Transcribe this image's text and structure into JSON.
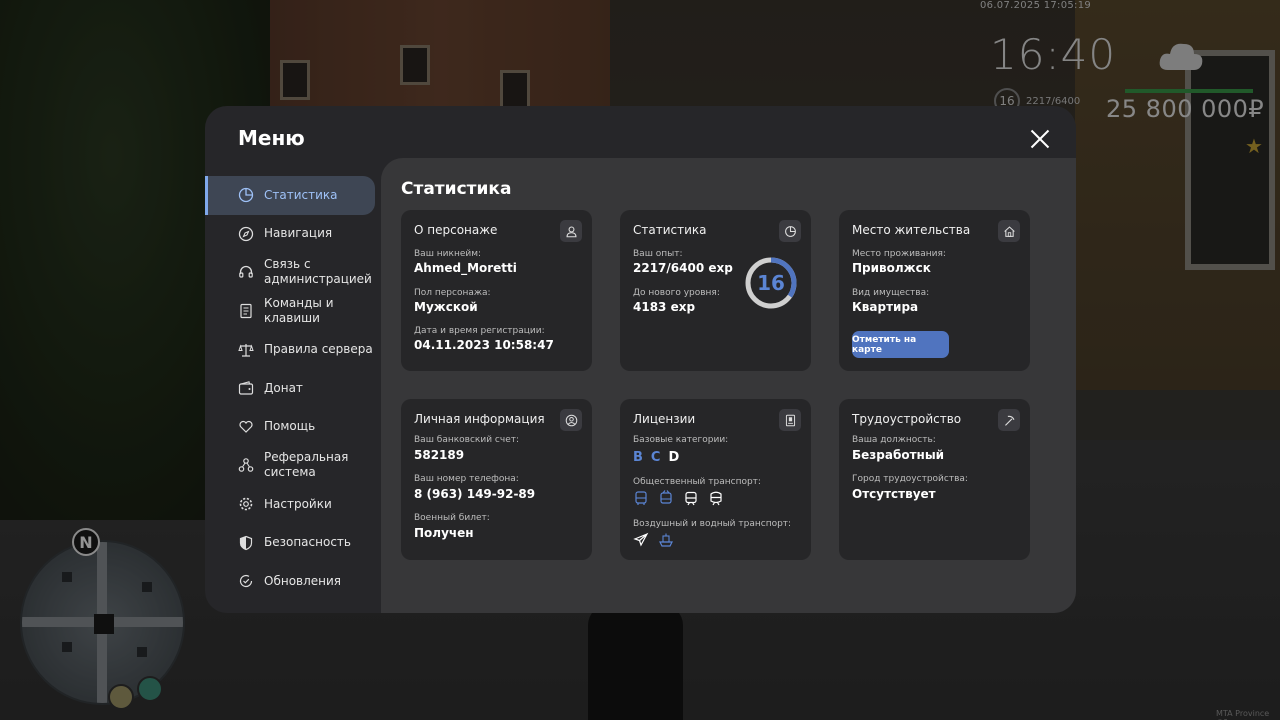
{
  "hud": {
    "datetime": "06.07.2025 17:05:19",
    "time": "16:40",
    "level": "16",
    "xp": "2217/6400",
    "money": "25 800 000₽",
    "brand": "MTA Province #6",
    "compass": "N"
  },
  "menu": {
    "title": "Меню",
    "sidebar": [
      {
        "label": "Статистика",
        "icon": "pie-chart-icon",
        "active": true
      },
      {
        "label": "Навигация",
        "icon": "compass-icon"
      },
      {
        "label": "Связь с администрацией",
        "icon": "headset-icon"
      },
      {
        "label": "Команды и клавиши",
        "icon": "document-icon"
      },
      {
        "label": "Правила сервера",
        "icon": "scales-icon"
      },
      {
        "label": "Донат",
        "icon": "wallet-icon"
      },
      {
        "label": "Помощь",
        "icon": "heart-hands-icon"
      },
      {
        "label": "Реферальная система",
        "icon": "network-icon"
      },
      {
        "label": "Настройки",
        "icon": "gear-icon"
      },
      {
        "label": "Безопасность",
        "icon": "shield-icon"
      },
      {
        "label": "Обновления",
        "icon": "refresh-check-icon"
      }
    ]
  },
  "content": {
    "title": "Статистика",
    "character": {
      "title": "О персонаже",
      "nick_label": "Ваш никнейм:",
      "nick": "Ahmed_Moretti",
      "gender_label": "Пол персонажа:",
      "gender": "Мужской",
      "reg_label": "Дата и время регистрации:",
      "reg": "04.11.2023 10:58:47"
    },
    "stats": {
      "title": "Статистика",
      "exp_label": "Ваш опыт:",
      "exp": "2217/6400 exp",
      "next_label": "До нового уровня:",
      "next": "4183 exp",
      "level": "16",
      "progress": 0.3464
    },
    "residence": {
      "title": "Место жительства",
      "place_label": "Место проживания:",
      "place": "Приволжск",
      "type_label": "Вид имущества:",
      "type": "Квартира",
      "button": "Отметить на карте"
    },
    "personal": {
      "title": "Личная информация",
      "bank_label": "Ваш банковский счет:",
      "bank": "582189",
      "phone_label": "Ваш номер телефона:",
      "phone": "8 (963) 149-92-89",
      "military_label": "Военный билет:",
      "military": "Получен"
    },
    "licenses": {
      "title": "Лицензии",
      "base_label": "Базовые категории:",
      "categories": [
        {
          "label": "B",
          "owned": false
        },
        {
          "label": "C",
          "owned": false
        },
        {
          "label": "D",
          "owned": true
        }
      ],
      "public_label": "Общественный транспорт:",
      "air_label": "Воздушный и водный транспорт:"
    },
    "employment": {
      "title": "Трудоустройство",
      "position_label": "Ваша должность:",
      "position": "Безработный",
      "city_label": "Город трудоустройства:",
      "city": "Отсутствует"
    }
  }
}
